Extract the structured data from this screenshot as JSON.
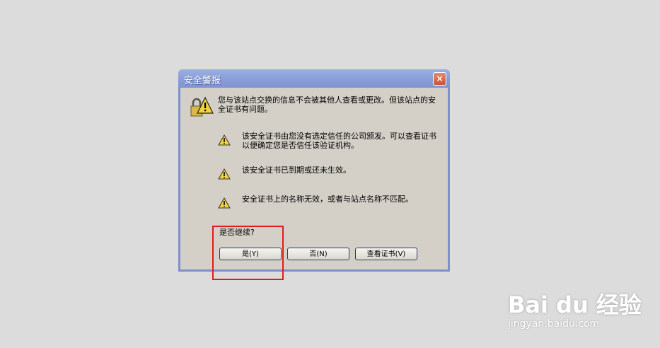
{
  "dialog": {
    "title": "安全警报",
    "close": "×",
    "main_message": "您与该站点交换的信息不会被其他人查看或更改。但该站点的安全证书有问题。",
    "warnings": [
      "该安全证书由您没有选定信任的公司颁发。可以查看证书以便确定您是否信任该验证机构。",
      "该安全证书已到期或还未生效。",
      "安全证书上的名称无效，或者与站点名称不匹配。"
    ],
    "question": "是否继续?",
    "buttons": {
      "yes": "是(Y)",
      "no": "否(N)",
      "view_cert": "查看证书(V)"
    }
  },
  "watermark": {
    "logo": "Bai du 经验",
    "url": "jingyan.baidu.com"
  },
  "colors": {
    "titlebar": "#8a9ed8",
    "dialog_bg": "#d4d0c8",
    "highlight": "#e01c1c",
    "warning_yellow": "#f4d23a"
  }
}
